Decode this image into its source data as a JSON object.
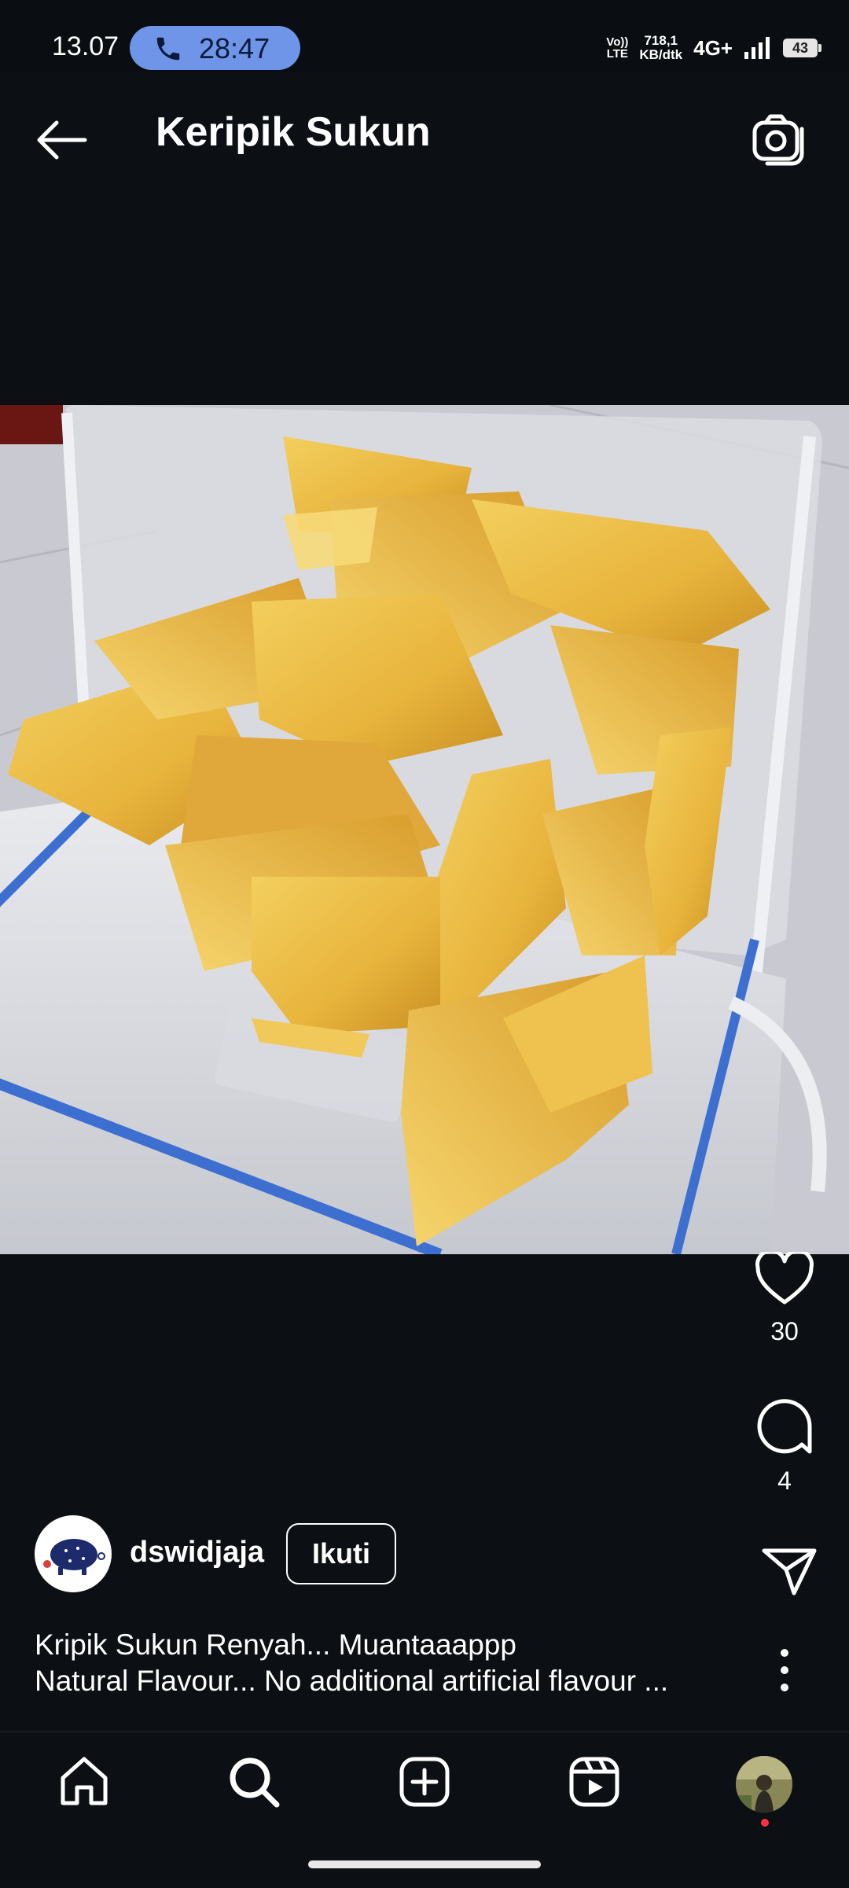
{
  "status_bar": {
    "time": "13.07",
    "call_timer": "28:47",
    "volte_top": "Vo))",
    "volte_bottom": "LTE",
    "speed_value": "718,1",
    "speed_unit": "KB/dtk",
    "network": "4G+",
    "battery": "43",
    "call_pill_color": "#6f95e8"
  },
  "header": {
    "title": "Keripik Sukun",
    "back_icon": "arrow-left-icon",
    "camera_icon": "camera-icon"
  },
  "post": {
    "image_subject": "breadfruit-chips-in-container",
    "likes": "30",
    "comments": "4",
    "author": "dswidjaja",
    "follow_label": "Ikuti",
    "caption_line1": "Kripik Sukun Renyah... Muantaaappp",
    "caption_line2": "Natural Flavour... No additional artificial flavour ..."
  },
  "bottom_nav": {
    "items": [
      "home-icon",
      "search-icon",
      "create-icon",
      "reels-icon",
      "profile-avatar"
    ],
    "notification_dot_color": "#ff3040"
  }
}
